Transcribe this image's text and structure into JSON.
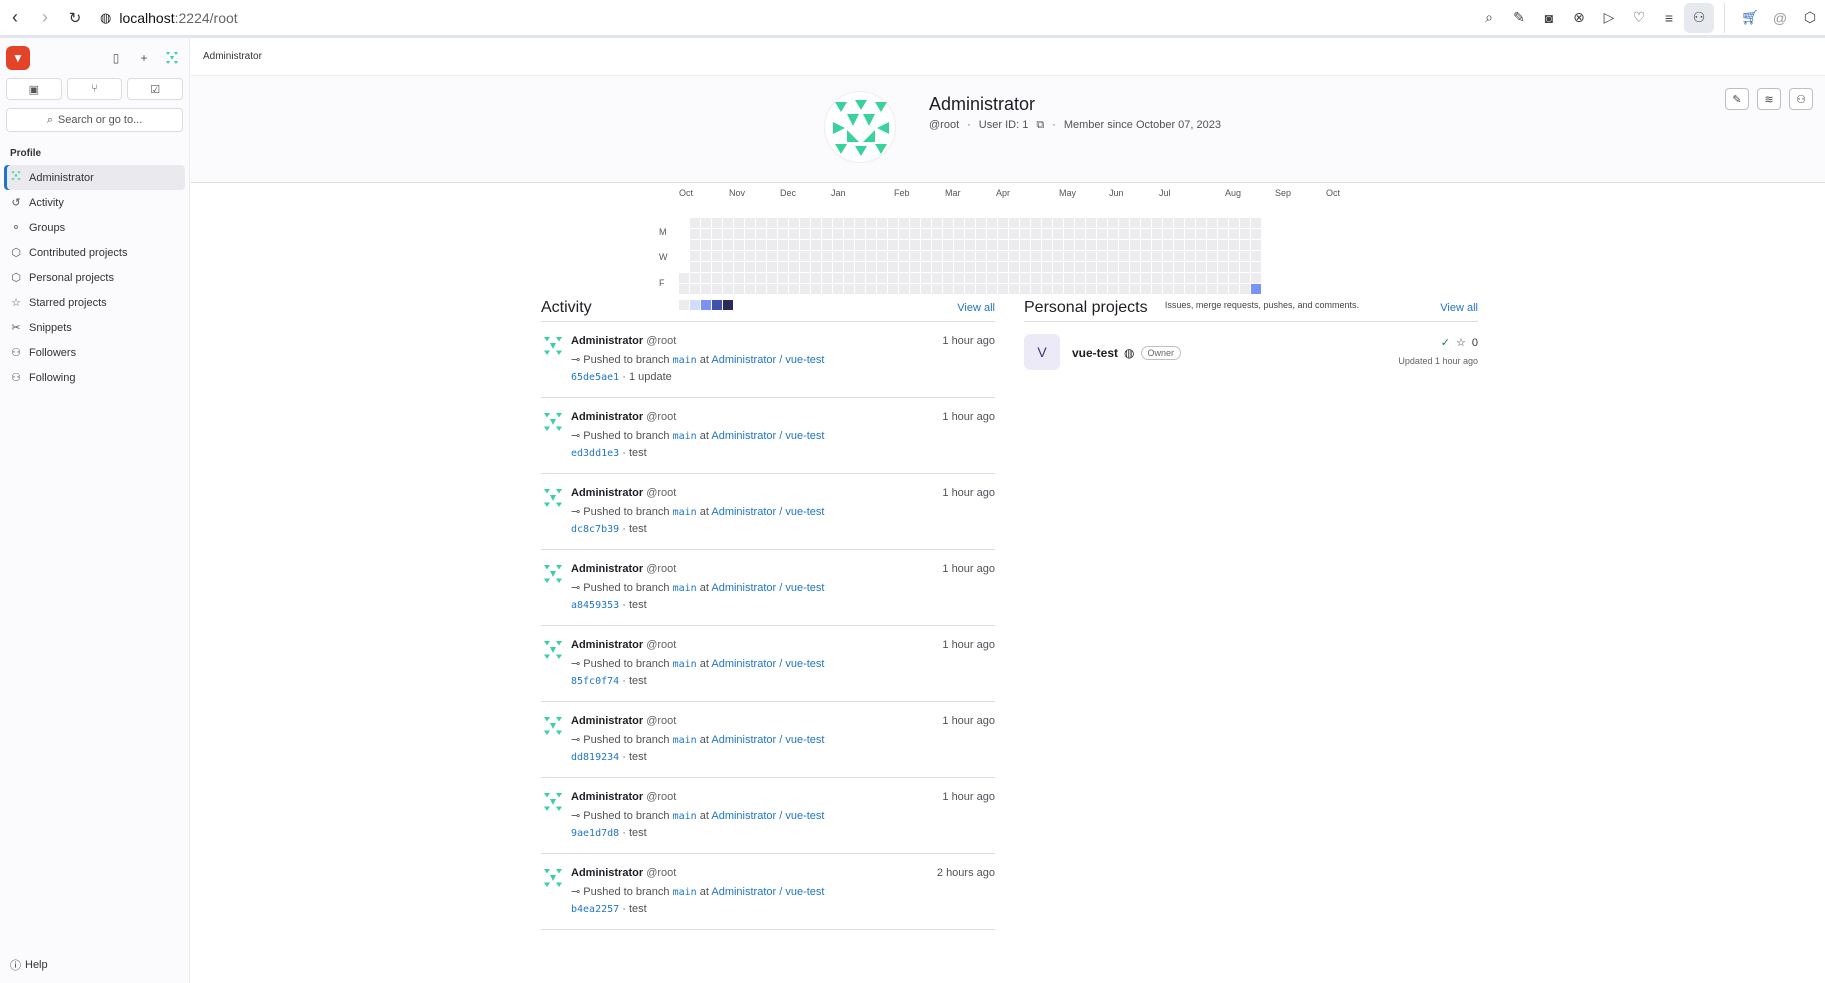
{
  "browser": {
    "url_host": "localhost",
    "url_path": ":2224/root"
  },
  "sidebar": {
    "section_title": "Profile",
    "search_placeholder": "Search or go to...",
    "items": [
      {
        "label": "Administrator",
        "icon": "identicon",
        "active": true
      },
      {
        "label": "Activity",
        "icon": "history-icon"
      },
      {
        "label": "Groups",
        "icon": "group-icon"
      },
      {
        "label": "Contributed projects",
        "icon": "project-icon"
      },
      {
        "label": "Personal projects",
        "icon": "project-icon"
      },
      {
        "label": "Starred projects",
        "icon": "star-icon"
      },
      {
        "label": "Snippets",
        "icon": "snippet-icon"
      },
      {
        "label": "Followers",
        "icon": "users-icon"
      },
      {
        "label": "Following",
        "icon": "users-icon"
      }
    ],
    "help_label": "Help"
  },
  "breadcrumb": "Administrator",
  "profile": {
    "name": "Administrator",
    "handle": "@root",
    "user_id": "User ID: 1",
    "member_since": "Member since October 07, 2023"
  },
  "calendar": {
    "months": [
      "Oct",
      "Nov",
      "Dec",
      "Jan",
      "Feb",
      "Mar",
      "Apr",
      "May",
      "Jun",
      "Jul",
      "Aug",
      "Sep",
      "Oct"
    ],
    "days": [
      "M",
      "W",
      "F"
    ],
    "note": "Issues, merge requests, pushes, and comments.",
    "colors": {
      "empty": "#ececef",
      "l1": "#d2dcff",
      "l2": "#7992f5",
      "l3": "#3f51ae",
      "l4": "#2a2b59"
    }
  },
  "activity": {
    "title": "Activity",
    "view_all": "View all",
    "events": [
      {
        "name": "Administrator",
        "handle": "@root",
        "time": "1 hour ago",
        "action": "Pushed to branch",
        "branch": "main",
        "at": "at",
        "project": "Administrator / vue-test",
        "sha": "65de5ae1",
        "msg": "· 1 update"
      },
      {
        "name": "Administrator",
        "handle": "@root",
        "time": "1 hour ago",
        "action": "Pushed to branch",
        "branch": "main",
        "at": "at",
        "project": "Administrator / vue-test",
        "sha": "ed3dd1e3",
        "msg": "· test"
      },
      {
        "name": "Administrator",
        "handle": "@root",
        "time": "1 hour ago",
        "action": "Pushed to branch",
        "branch": "main",
        "at": "at",
        "project": "Administrator / vue-test",
        "sha": "dc8c7b39",
        "msg": "· test"
      },
      {
        "name": "Administrator",
        "handle": "@root",
        "time": "1 hour ago",
        "action": "Pushed to branch",
        "branch": "main",
        "at": "at",
        "project": "Administrator / vue-test",
        "sha": "a8459353",
        "msg": "· test"
      },
      {
        "name": "Administrator",
        "handle": "@root",
        "time": "1 hour ago",
        "action": "Pushed to branch",
        "branch": "main",
        "at": "at",
        "project": "Administrator / vue-test",
        "sha": "85fc0f74",
        "msg": "· test"
      },
      {
        "name": "Administrator",
        "handle": "@root",
        "time": "1 hour ago",
        "action": "Pushed to branch",
        "branch": "main",
        "at": "at",
        "project": "Administrator / vue-test",
        "sha": "dd819234",
        "msg": "· test"
      },
      {
        "name": "Administrator",
        "handle": "@root",
        "time": "1 hour ago",
        "action": "Pushed to branch",
        "branch": "main",
        "at": "at",
        "project": "Administrator / vue-test",
        "sha": "9ae1d7d8",
        "msg": "· test"
      },
      {
        "name": "Administrator",
        "handle": "@root",
        "time": "2 hours ago",
        "action": "Pushed to branch",
        "branch": "main",
        "at": "at",
        "project": "Administrator / vue-test",
        "sha": "b4ea2257",
        "msg": "· test"
      }
    ]
  },
  "projects": {
    "title": "Personal projects",
    "view_all": "View all",
    "items": [
      {
        "initial": "V",
        "name": "vue-test",
        "role": "Owner",
        "stars": "0",
        "updated": "Updated 1 hour ago"
      }
    ]
  }
}
